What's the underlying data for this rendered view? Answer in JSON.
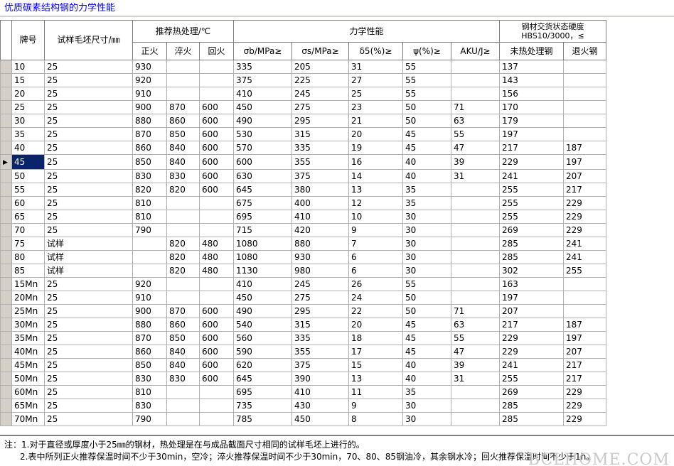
{
  "window": {
    "title": "优质碳素结构钢的力学性能"
  },
  "header": {
    "grade": "牌号",
    "blank_size": "试样毛坯尺寸/㎜",
    "heat_treatment": "推荐热处理/℃",
    "normalizing": "正火",
    "quenching": "淬火",
    "tempering": "回火",
    "mechanical": "力学性能",
    "sigma_b": "σb/MPa≥",
    "sigma_s": "σs/MPa≥",
    "delta5": "δ5(%)≥",
    "psi": "ψ(%)≥",
    "aku": "AKU/J≥",
    "hardness_line1": "钢材交货状态硬度",
    "hardness_line2": "HBS10/3000，≤",
    "untreated": "未热处理钢",
    "annealed": "退火钢"
  },
  "rows": [
    [
      "10",
      "25",
      "930",
      "",
      "",
      "335",
      "205",
      "31",
      "55",
      "",
      "137",
      ""
    ],
    [
      "15",
      "25",
      "920",
      "",
      "",
      "375",
      "225",
      "27",
      "55",
      "",
      "143",
      ""
    ],
    [
      "20",
      "25",
      "910",
      "",
      "",
      "410",
      "245",
      "25",
      "55",
      "",
      "156",
      ""
    ],
    [
      "25",
      "25",
      "900",
      "870",
      "600",
      "450",
      "275",
      "23",
      "50",
      "71",
      "170",
      ""
    ],
    [
      "30",
      "25",
      "880",
      "860",
      "600",
      "490",
      "295",
      "21",
      "50",
      "63",
      "179",
      ""
    ],
    [
      "35",
      "25",
      "870",
      "850",
      "600",
      "530",
      "315",
      "20",
      "45",
      "55",
      "197",
      ""
    ],
    [
      "40",
      "25",
      "860",
      "840",
      "600",
      "570",
      "335",
      "19",
      "45",
      "47",
      "217",
      "187"
    ],
    [
      "45",
      "25",
      "850",
      "840",
      "600",
      "600",
      "355",
      "16",
      "40",
      "39",
      "229",
      "197"
    ],
    [
      "50",
      "25",
      "830",
      "830",
      "600",
      "630",
      "375",
      "14",
      "40",
      "31",
      "241",
      "207"
    ],
    [
      "55",
      "25",
      "820",
      "820",
      "600",
      "645",
      "380",
      "13",
      "35",
      "",
      "255",
      "217"
    ],
    [
      "60",
      "25",
      "810",
      "",
      "",
      "675",
      "400",
      "12",
      "35",
      "",
      "255",
      "229"
    ],
    [
      "65",
      "25",
      "810",
      "",
      "",
      "695",
      "410",
      "10",
      "30",
      "",
      "255",
      "229"
    ],
    [
      "70",
      "25",
      "790",
      "",
      "",
      "715",
      "420",
      "9",
      "30",
      "",
      "269",
      "229"
    ],
    [
      "75",
      "试样",
      "",
      "820",
      "480",
      "1080",
      "880",
      "7",
      "30",
      "",
      "285",
      "241"
    ],
    [
      "80",
      "试样",
      "",
      "820",
      "480",
      "1080",
      "930",
      "6",
      "30",
      "",
      "285",
      "241"
    ],
    [
      "85",
      "试样",
      "",
      "820",
      "480",
      "1130",
      "980",
      "6",
      "30",
      "",
      "302",
      "255"
    ],
    [
      "15Mn",
      "25",
      "920",
      "",
      "",
      "410",
      "245",
      "26",
      "55",
      "",
      "163",
      ""
    ],
    [
      "20Mn",
      "25",
      "910",
      "",
      "",
      "450",
      "275",
      "24",
      "50",
      "",
      "197",
      ""
    ],
    [
      "25Mn",
      "25",
      "900",
      "870",
      "600",
      "490",
      "295",
      "22",
      "50",
      "71",
      "207",
      ""
    ],
    [
      "30Mn",
      "25",
      "880",
      "860",
      "600",
      "540",
      "315",
      "20",
      "45",
      "63",
      "217",
      "187"
    ],
    [
      "35Mn",
      "25",
      "870",
      "850",
      "600",
      "560",
      "335",
      "18",
      "45",
      "55",
      "229",
      "197"
    ],
    [
      "40Mn",
      "25",
      "860",
      "840",
      "600",
      "590",
      "355",
      "17",
      "45",
      "47",
      "229",
      "207"
    ],
    [
      "45Mn",
      "25",
      "850",
      "840",
      "600",
      "620",
      "375",
      "15",
      "40",
      "39",
      "241",
      "217"
    ],
    [
      "50Mn",
      "25",
      "830",
      "830",
      "600",
      "645",
      "390",
      "13",
      "40",
      "31",
      "255",
      "217"
    ],
    [
      "60Mn",
      "25",
      "810",
      "",
      "",
      "695",
      "410",
      "11",
      "35",
      "",
      "269",
      "229"
    ],
    [
      "65Mn",
      "25",
      "830",
      "",
      "",
      "735",
      "430",
      "9",
      "30",
      "",
      "285",
      "229"
    ],
    [
      "70Mn",
      "25",
      "790",
      "",
      "",
      "785",
      "450",
      "8",
      "30",
      "",
      "285",
      "229"
    ]
  ],
  "selected_row": 7,
  "notes": {
    "line1": "注：1.对于直径或厚度小于25㎜的钢材，热处理是在与成品截面尺寸相同的试样毛坯上进行的。",
    "line2": "2.表中所列正火推荐保温时间不少于30min，空冷；淬火推荐保温时间不少于30min，70、80、85钢油冷，其余钢水冷；回火推荐保温时间不少于1h。"
  },
  "watermark": "BCLHOME.COM",
  "colors": {
    "title": "#0000ff",
    "selection": "#0a246a",
    "header_bg": "#d4d0c8"
  }
}
